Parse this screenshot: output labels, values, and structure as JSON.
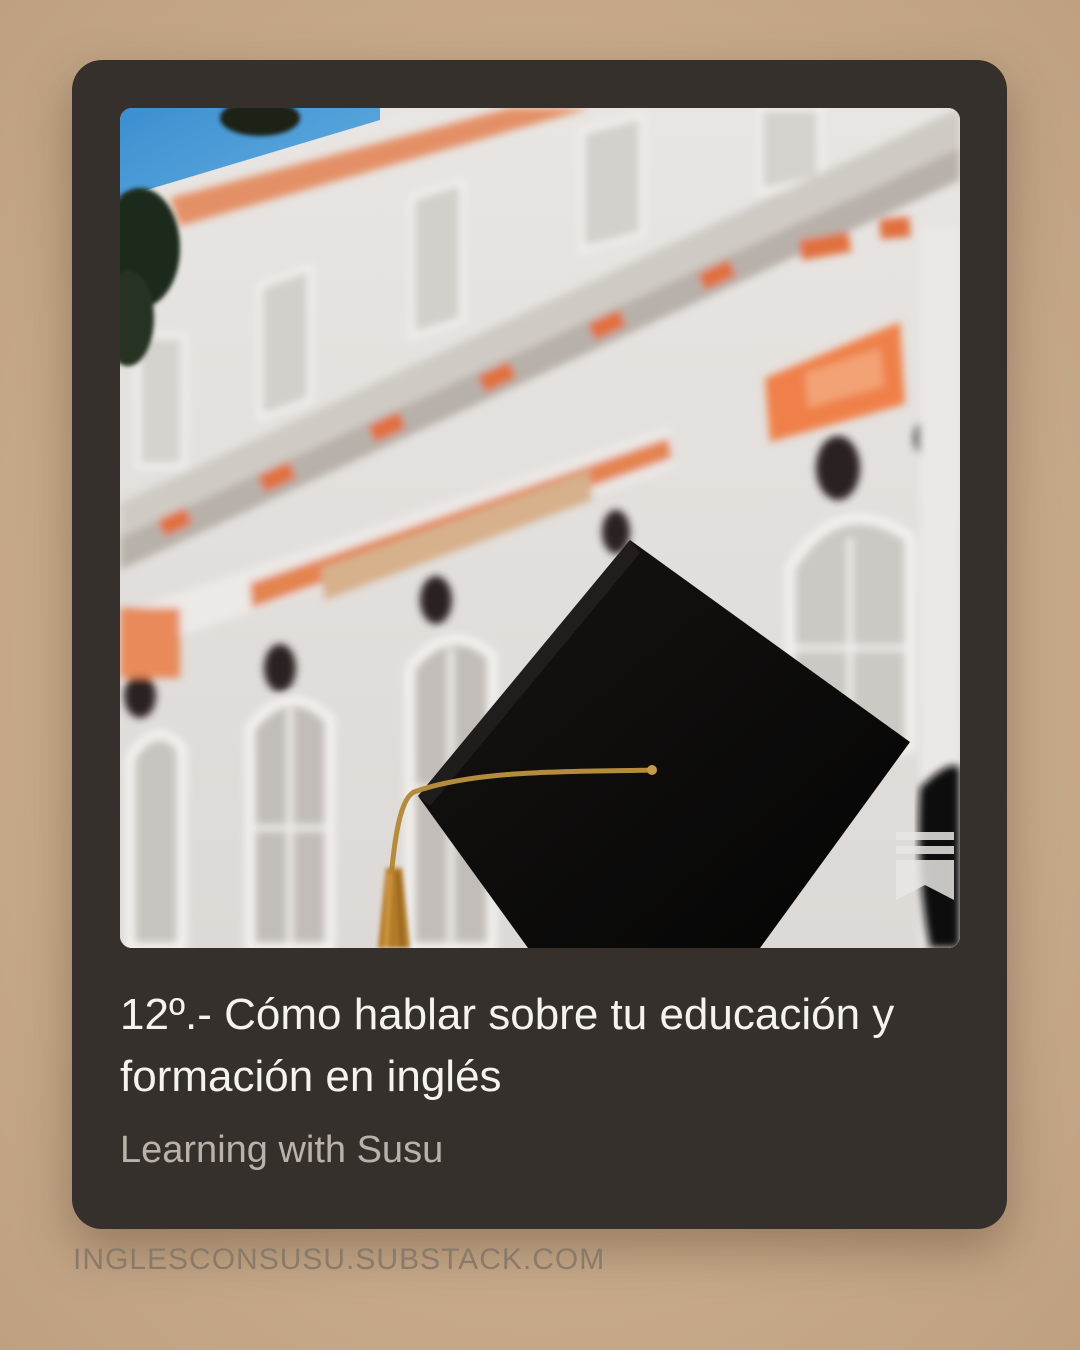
{
  "post": {
    "title": "12º.- Cómo hablar sobre tu educación y formación en inglés",
    "publication": "Learning with Susu",
    "domain": "INGLESCONSUSU.SUBSTACK.COM",
    "image_icon": "graduation-cap-building-photo",
    "badge_icon": "bookmark-icon"
  },
  "colors": {
    "card_background": "#35302c",
    "page_background": "#c9ac8c",
    "title_text": "#f6f3ef",
    "subtitle_text": "#b9b2ab",
    "domain_text": "#8a7a6a"
  }
}
